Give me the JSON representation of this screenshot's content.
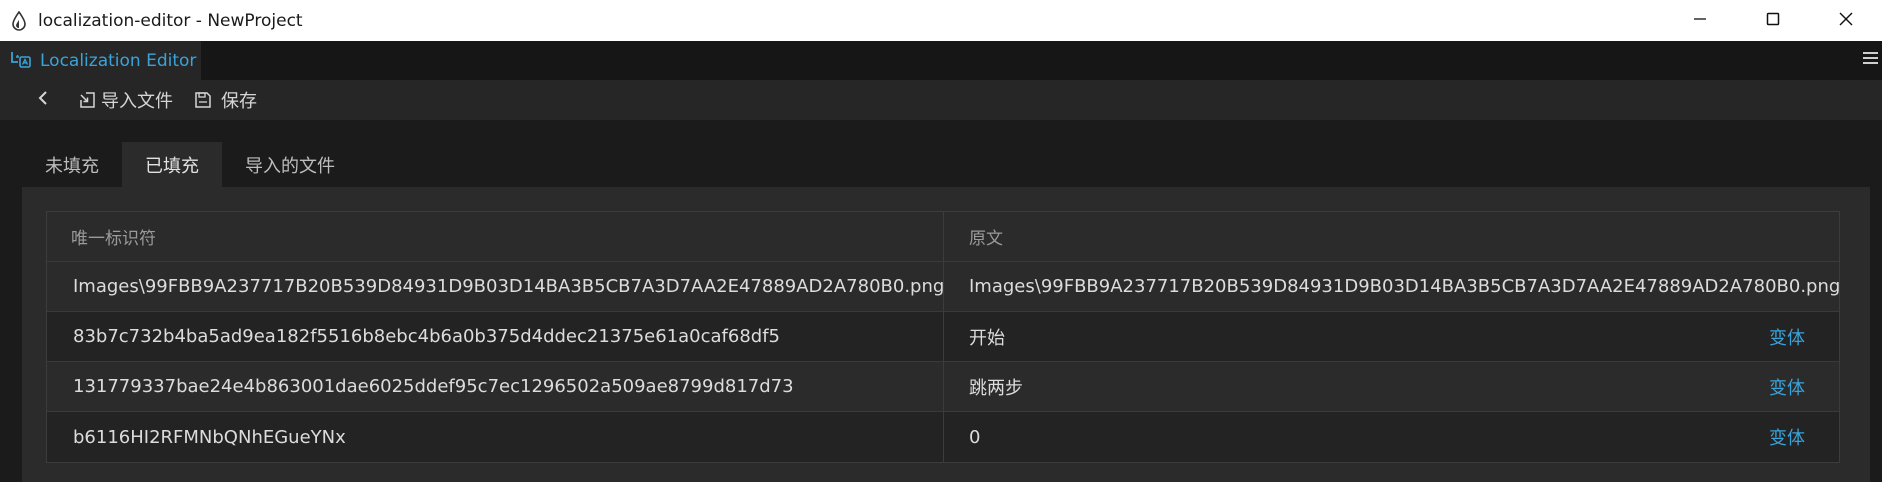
{
  "window": {
    "title": "localization-editor - NewProject",
    "icons": {
      "app": "droplet-icon",
      "minimize": "minimize-icon",
      "maximize": "maximize-icon",
      "close": "close-icon"
    }
  },
  "panel": {
    "tab_label": "Localization Editor",
    "tab_icon": "localization-icon",
    "menu_icon": "hamburger-menu-icon"
  },
  "toolbar": {
    "back_icon": "chevron-left-icon",
    "import_label": "导入文件",
    "import_icon": "import-file-icon",
    "save_label": "保存",
    "save_icon": "save-icon"
  },
  "tabs": {
    "unfilled": "未填充",
    "filled": "已填充",
    "imported": "导入的文件",
    "active": "filled"
  },
  "table": {
    "columns": {
      "id": "唯一标识符",
      "source": "原文"
    },
    "rows": [
      {
        "id": "Images\\99FBB9A237717B20B539D84931D9B03D14BA3B5CB7A3D7AA2E47889AD2A780B0.png",
        "source": "Images\\99FBB9A237717B20B539D84931D9B03D14BA3B5CB7A3D7AA2E47889AD2A780B0.png",
        "variant": ""
      },
      {
        "id": "83b7c732b4ba5ad9ea182f5516b8ebc4b6a0b375d4ddec21375e61a0caf68df5",
        "source": "开始",
        "variant": "变体"
      },
      {
        "id": "131779337bae24e4b863001dae6025ddef95c7ec1296502a509ae8799d817d73",
        "source": "跳两步",
        "variant": "变体"
      },
      {
        "id": "b6116HI2RFMNbQNhEGueYNx",
        "source": "0",
        "variant": "变体"
      }
    ]
  },
  "colors": {
    "accent": "#3aa3d9",
    "background": "#1b1b1b",
    "panel": "#2b2b2b"
  }
}
